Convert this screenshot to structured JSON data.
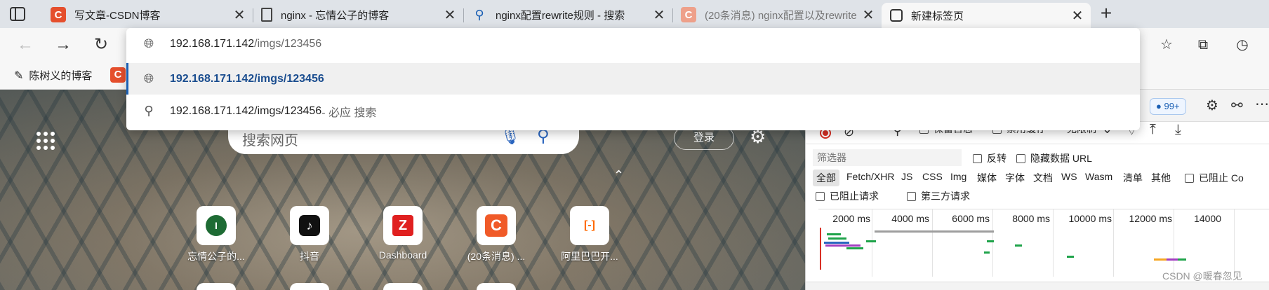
{
  "tabs": [
    {
      "title": "写文章-CSDN博客",
      "icon": "csdn-icon",
      "active": false
    },
    {
      "title": "nginx - 忘情公子的博客",
      "icon": "document-icon",
      "active": false
    },
    {
      "title": "nginx配置rewrite规则 - 搜索",
      "icon": "search-icon",
      "active": false
    },
    {
      "title": "(20条消息) nginx配置以及rewrite",
      "icon": "csdn-icon",
      "active": false
    },
    {
      "title": "新建标签页",
      "icon": "newtab-icon",
      "active": true
    }
  ],
  "tab_close_glyph": "✕",
  "new_tab_glyph": "+",
  "address_bar": {
    "value": "192.168.171.142/imgs/123456"
  },
  "omnibox": {
    "suggestions": [
      {
        "host": "192.168.171.142",
        "path": "/imgs/123456",
        "suffix": "",
        "icon": "globe-icon",
        "selected": false
      },
      {
        "host": "192.168.171.142",
        "path": "/imgs/123456",
        "suffix": "",
        "icon": "globe-icon",
        "selected": true
      },
      {
        "host": "192.168.171.142/imgs/123456",
        "path": "",
        "suffix": " - 必应 搜索",
        "icon": "search-icon",
        "selected": false
      }
    ]
  },
  "bookmarks": [
    {
      "label": "陈树义的博客",
      "icon": "feather-icon"
    }
  ],
  "ntp": {
    "search_placeholder": "搜索网页",
    "login_label": "登录",
    "tiles": [
      {
        "label": "忘情公子的...",
        "icon_text": "I",
        "bg": "#1e6b34"
      },
      {
        "label": "抖音",
        "icon_text": "♪",
        "bg": "#111111"
      },
      {
        "label": "Dashboard",
        "icon_text": "Z",
        "bg": "#e02020"
      },
      {
        "label": "(20条消息) ...",
        "icon_text": "C",
        "bg": "#f05a28"
      },
      {
        "label": "阿里巴巴开...",
        "icon_text": "[-]",
        "bg": "#ff6a00"
      }
    ]
  },
  "devtools": {
    "notification_badge": "99+",
    "partial_labels": [
      "保留日志",
      "禁用缓存",
      "无限制"
    ],
    "filter_placeholder": "筛选器",
    "filter_checks": [
      "反转",
      "隐藏数据 URL"
    ],
    "types": [
      "全部",
      "Fetch/XHR",
      "JS",
      "CSS",
      "Img",
      "媒体",
      "字体",
      "文档",
      "WS",
      "Wasm",
      "清单",
      "其他"
    ],
    "blocked_cookies_label": "已阻止 Co",
    "row4_checks": [
      "已阻止请求",
      "第三方请求"
    ],
    "timeline_ticks": [
      "2000 ms",
      "4000 ms",
      "6000 ms",
      "8000 ms",
      "10000 ms",
      "12000 ms",
      "14000"
    ]
  },
  "watermark": "CSDN @暖春忽见",
  "colors": {
    "csdn_red": "#e54f2d",
    "link_blue": "#1a5fb4",
    "record_red": "#d93025"
  }
}
